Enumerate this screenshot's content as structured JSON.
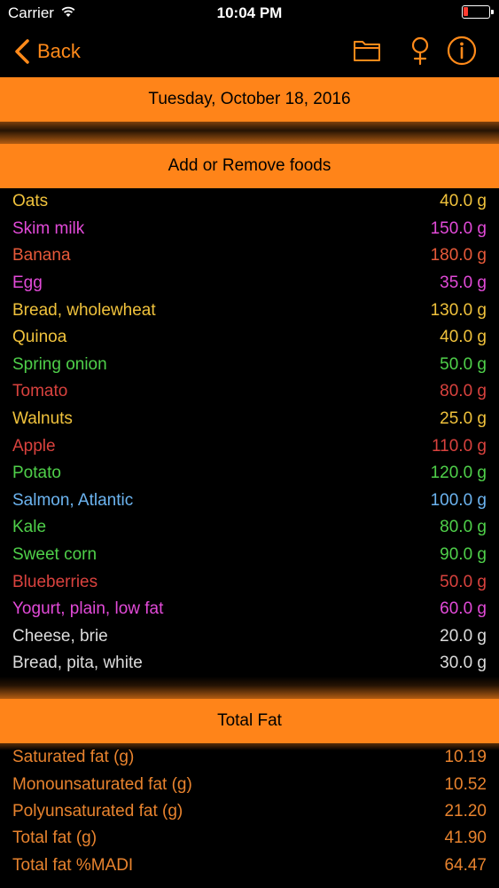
{
  "status_bar": {
    "carrier": "Carrier",
    "time": "10:04 PM",
    "battery_color": "#ff3b30"
  },
  "nav": {
    "back_label": "Back",
    "icons": [
      "chevron-left-icon",
      "folder-icon",
      "female-symbol-icon",
      "info-icon"
    ],
    "accent_color": "#ff8a1a"
  },
  "date_band": {
    "label": "Tuesday, October 18, 2016"
  },
  "add_band": {
    "label": "Add or Remove foods"
  },
  "foods": [
    {
      "name": "Oats",
      "amount": "40.0 g",
      "color": "#f0c23c"
    },
    {
      "name": "Skim milk",
      "amount": "150.0 g",
      "color": "#e24ad8"
    },
    {
      "name": "Banana",
      "amount": "180.0 g",
      "color": "#e85a3a"
    },
    {
      "name": "Egg",
      "amount": "35.0 g",
      "color": "#e24ad8"
    },
    {
      "name": "Bread, wholewheat",
      "amount": "130.0 g",
      "color": "#f0c23c"
    },
    {
      "name": "Quinoa",
      "amount": "40.0 g",
      "color": "#f0c23c"
    },
    {
      "name": "Spring onion",
      "amount": "50.0 g",
      "color": "#4fd04a"
    },
    {
      "name": "Tomato",
      "amount": "80.0 g",
      "color": "#d9423e"
    },
    {
      "name": "Walnuts",
      "amount": "25.0 g",
      "color": "#f0c23c"
    },
    {
      "name": "Apple",
      "amount": "110.0 g",
      "color": "#d9423e"
    },
    {
      "name": "Potato",
      "amount": "120.0 g",
      "color": "#4fd04a"
    },
    {
      "name": "Salmon, Atlantic",
      "amount": "100.0 g",
      "color": "#6cb4f0"
    },
    {
      "name": "Kale",
      "amount": "80.0 g",
      "color": "#4fd04a"
    },
    {
      "name": "Sweet corn",
      "amount": "90.0 g",
      "color": "#4fd04a"
    },
    {
      "name": "Blueberries",
      "amount": "50.0 g",
      "color": "#d9423e"
    },
    {
      "name": "Yogurt, plain, low fat",
      "amount": "60.0 g",
      "color": "#e24ad8"
    },
    {
      "name": "Cheese, brie",
      "amount": "20.0 g",
      "color": "#dcdcdc"
    },
    {
      "name": "Bread, pita, white",
      "amount": "30.0 g",
      "color": "#dcdcdc"
    }
  ],
  "fat_band": {
    "label": "Total Fat"
  },
  "fat_rows": [
    {
      "name": "Saturated fat (g)",
      "value": "10.19"
    },
    {
      "name": "Monounsaturated fat (g)",
      "value": "10.52"
    },
    {
      "name": "Polyunsaturated fat (g)",
      "value": "21.20"
    },
    {
      "name": "Total fat (g)",
      "value": "41.90"
    },
    {
      "name": "Total fat %MADI",
      "value": "64.47"
    }
  ],
  "colors": {
    "band": "#ff8419",
    "fat_text": "#e8832e"
  }
}
